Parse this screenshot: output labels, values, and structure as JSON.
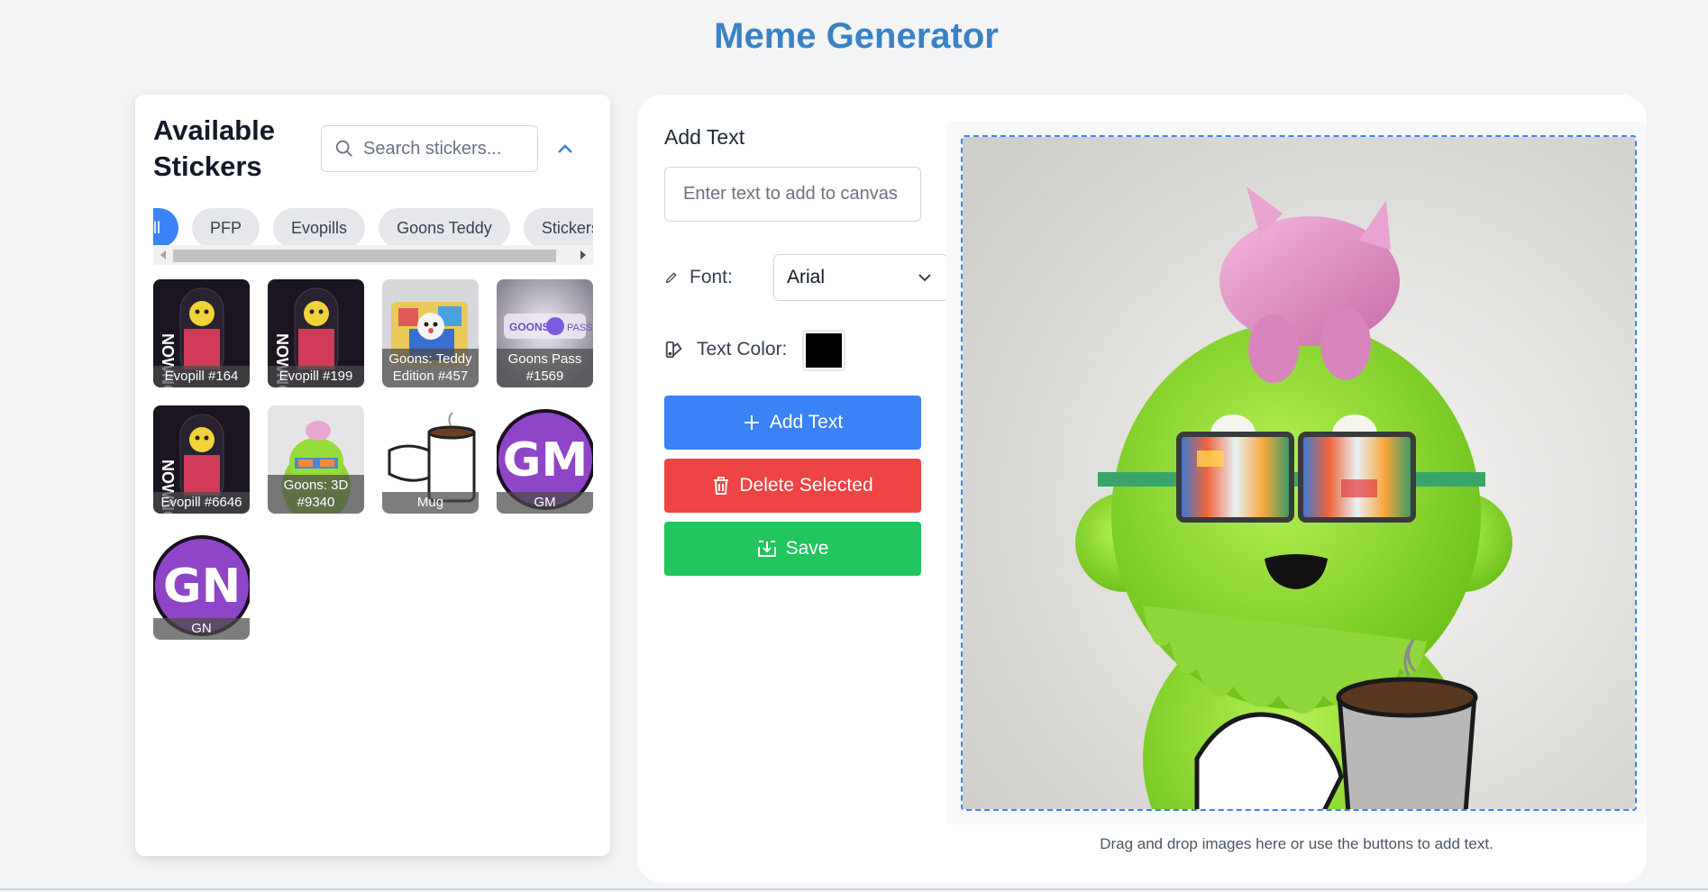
{
  "header": {
    "title": "Meme Generator"
  },
  "stickers_panel": {
    "title": "Available Stickers",
    "search_placeholder": "Search stickers...",
    "categories": [
      {
        "label": "All",
        "active": true
      },
      {
        "label": "PFP",
        "active": false
      },
      {
        "label": "Evopills",
        "active": false
      },
      {
        "label": "Goons Teddy",
        "active": false
      },
      {
        "label": "Stickers",
        "active": false
      }
    ],
    "stickers": [
      {
        "label": "Evopill #164",
        "icon": "evopill-art"
      },
      {
        "label": "Evopill #199",
        "icon": "evopill-art"
      },
      {
        "label": "Goons: Teddy Edition #457",
        "icon": "teddy-art"
      },
      {
        "label": "Goons Pass #1569",
        "icon": "pass-art"
      },
      {
        "label": "Evopill #6646",
        "icon": "evopill-art"
      },
      {
        "label": "Goons: 3D #9340",
        "icon": "goon-3d-art"
      },
      {
        "label": "Mug",
        "icon": "mug-art"
      },
      {
        "label": "GM",
        "icon": "gm-art"
      },
      {
        "label": "GN",
        "icon": "gn-art"
      }
    ]
  },
  "editor": {
    "add_text_label": "Add Text",
    "text_placeholder": "Enter text to add to canvas",
    "font_label": "Font:",
    "font_value": "Arial",
    "color_label": "Text Color:",
    "color_value": "#000000",
    "add_button": "Add Text",
    "delete_button": "Delete Selected",
    "save_button": "Save",
    "hint": "Drag and drop images here or use the buttons to add text."
  },
  "colors": {
    "accent": "#3b82f6",
    "title": "#3b82c4",
    "danger": "#ef4444",
    "success": "#22c55e"
  }
}
